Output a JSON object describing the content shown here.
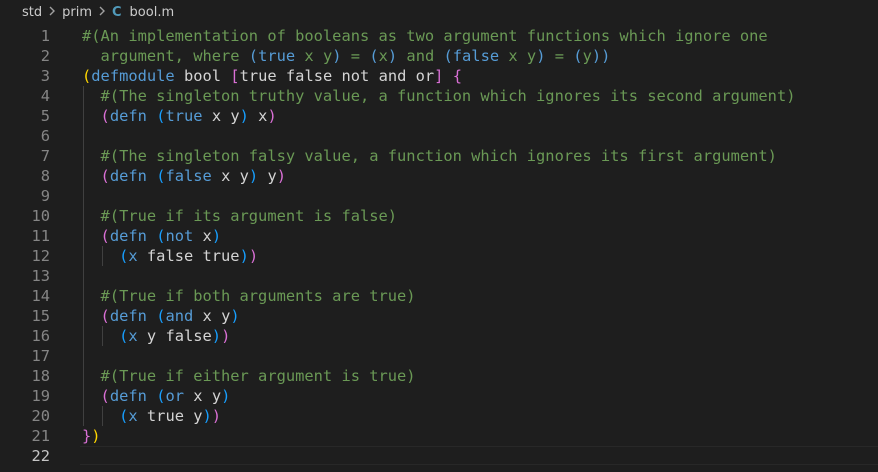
{
  "breadcrumb": {
    "items": [
      "std",
      "prim"
    ],
    "file_icon": "C",
    "file_name": "bool.m"
  },
  "colors": {
    "background": "#1e1e1e",
    "line_number": "#858585",
    "comment": "#6a9955",
    "keyword": "#569cd6",
    "text": "#d4d4d4",
    "bracket_1": "#ffd700",
    "bracket_2": "#da70d6",
    "bracket_3": "#179fff",
    "file_icon": "#519aba"
  },
  "current_line": 22,
  "lines": [
    {
      "n": "1",
      "guides": 0,
      "tokens": [
        [
          "t-comment",
          "#(An implementation of booleans as two argument functions which ignore one"
        ]
      ]
    },
    {
      "n": "2",
      "guides": 0,
      "tokens": [
        [
          "t-comment",
          "  argument, where "
        ],
        [
          "t-kw",
          "(true"
        ],
        [
          "t-comment",
          " x y"
        ],
        [
          "t-kw",
          ")"
        ],
        [
          "t-comment",
          " = "
        ],
        [
          "t-kw",
          "("
        ],
        [
          "t-comment",
          "x"
        ],
        [
          "t-kw",
          ")"
        ],
        [
          "t-comment",
          " and "
        ],
        [
          "t-kw",
          "(false"
        ],
        [
          "t-comment",
          " x y"
        ],
        [
          "t-kw",
          ")"
        ],
        [
          "t-comment",
          " = "
        ],
        [
          "t-kw",
          "("
        ],
        [
          "t-comment",
          "y"
        ],
        [
          "t-kw",
          "))"
        ]
      ]
    },
    {
      "n": "3",
      "guides": 0,
      "tokens": [
        [
          "t-p1",
          "("
        ],
        [
          "t-kw",
          "defmodule"
        ],
        [
          "t-plain",
          " bool "
        ],
        [
          "t-p2",
          "["
        ],
        [
          "t-plain",
          "true false not and or"
        ],
        [
          "t-p2",
          "]"
        ],
        [
          "t-plain",
          " "
        ],
        [
          "t-p2",
          "{"
        ]
      ]
    },
    {
      "n": "4",
      "guides": 1,
      "tokens": [
        [
          "t-comment",
          "  #(The singleton truthy value, a function which ignores its second argument)"
        ]
      ]
    },
    {
      "n": "5",
      "guides": 1,
      "tokens": [
        [
          "t-plain",
          "  "
        ],
        [
          "t-p2",
          "("
        ],
        [
          "t-kw",
          "defn"
        ],
        [
          "t-plain",
          " "
        ],
        [
          "t-p3",
          "("
        ],
        [
          "t-kw",
          "true"
        ],
        [
          "t-plain",
          " x y"
        ],
        [
          "t-p3",
          ")"
        ],
        [
          "t-plain",
          " x"
        ],
        [
          "t-p2",
          ")"
        ]
      ]
    },
    {
      "n": "6",
      "guides": 1,
      "tokens": []
    },
    {
      "n": "7",
      "guides": 1,
      "tokens": [
        [
          "t-comment",
          "  #(The singleton falsy value, a function which ignores its first argument)"
        ]
      ]
    },
    {
      "n": "8",
      "guides": 1,
      "tokens": [
        [
          "t-plain",
          "  "
        ],
        [
          "t-p2",
          "("
        ],
        [
          "t-kw",
          "defn"
        ],
        [
          "t-plain",
          " "
        ],
        [
          "t-p3",
          "("
        ],
        [
          "t-kw",
          "false"
        ],
        [
          "t-plain",
          " x y"
        ],
        [
          "t-p3",
          ")"
        ],
        [
          "t-plain",
          " y"
        ],
        [
          "t-p2",
          ")"
        ]
      ]
    },
    {
      "n": "9",
      "guides": 1,
      "tokens": []
    },
    {
      "n": "10",
      "guides": 1,
      "tokens": [
        [
          "t-comment",
          "  #(True if its argument is false)"
        ]
      ]
    },
    {
      "n": "11",
      "guides": 1,
      "tokens": [
        [
          "t-plain",
          "  "
        ],
        [
          "t-p2",
          "("
        ],
        [
          "t-kw",
          "defn"
        ],
        [
          "t-plain",
          " "
        ],
        [
          "t-p3",
          "("
        ],
        [
          "t-kw",
          "not"
        ],
        [
          "t-plain",
          " x"
        ],
        [
          "t-p3",
          ")"
        ]
      ]
    },
    {
      "n": "12",
      "guides": 2,
      "tokens": [
        [
          "t-plain",
          "    "
        ],
        [
          "t-p3",
          "("
        ],
        [
          "t-kw",
          "x"
        ],
        [
          "t-plain",
          " false true"
        ],
        [
          "t-p3",
          ")"
        ],
        [
          "t-p2",
          ")"
        ]
      ]
    },
    {
      "n": "13",
      "guides": 1,
      "tokens": []
    },
    {
      "n": "14",
      "guides": 1,
      "tokens": [
        [
          "t-comment",
          "  #(True if both arguments are true)"
        ]
      ]
    },
    {
      "n": "15",
      "guides": 1,
      "tokens": [
        [
          "t-plain",
          "  "
        ],
        [
          "t-p2",
          "("
        ],
        [
          "t-kw",
          "defn"
        ],
        [
          "t-plain",
          " "
        ],
        [
          "t-p3",
          "("
        ],
        [
          "t-kw",
          "and"
        ],
        [
          "t-plain",
          " x y"
        ],
        [
          "t-p3",
          ")"
        ]
      ]
    },
    {
      "n": "16",
      "guides": 2,
      "tokens": [
        [
          "t-plain",
          "    "
        ],
        [
          "t-p3",
          "("
        ],
        [
          "t-kw",
          "x"
        ],
        [
          "t-plain",
          " y false"
        ],
        [
          "t-p3",
          ")"
        ],
        [
          "t-p2",
          ")"
        ]
      ]
    },
    {
      "n": "17",
      "guides": 1,
      "tokens": []
    },
    {
      "n": "18",
      "guides": 1,
      "tokens": [
        [
          "t-comment",
          "  #(True if either argument is true)"
        ]
      ]
    },
    {
      "n": "19",
      "guides": 1,
      "tokens": [
        [
          "t-plain",
          "  "
        ],
        [
          "t-p2",
          "("
        ],
        [
          "t-kw",
          "defn"
        ],
        [
          "t-plain",
          " "
        ],
        [
          "t-p3",
          "("
        ],
        [
          "t-kw",
          "or"
        ],
        [
          "t-plain",
          " x y"
        ],
        [
          "t-p3",
          ")"
        ]
      ]
    },
    {
      "n": "20",
      "guides": 2,
      "tokens": [
        [
          "t-plain",
          "    "
        ],
        [
          "t-p3",
          "("
        ],
        [
          "t-kw",
          "x"
        ],
        [
          "t-plain",
          " true y"
        ],
        [
          "t-p3",
          ")"
        ],
        [
          "t-p2",
          ")"
        ]
      ]
    },
    {
      "n": "21",
      "guides": 0,
      "tokens": [
        [
          "t-p2",
          "}"
        ],
        [
          "t-p1",
          ")"
        ]
      ]
    },
    {
      "n": "22",
      "guides": 0,
      "tokens": []
    }
  ]
}
